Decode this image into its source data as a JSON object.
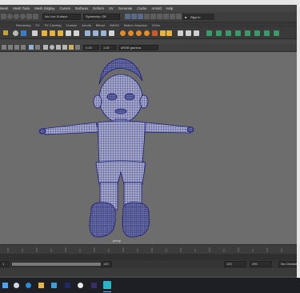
{
  "menu": {
    "items": [
      "Mesh",
      "Mesh Tools",
      "Mesh Display",
      "Curves",
      "Surfaces",
      "Deform",
      "UV",
      "Generate",
      "Cache",
      "Arnold",
      "Help"
    ]
  },
  "status_line": {
    "live_surface": "No Live Surface",
    "symmetry": "Symmetry: Off",
    "sign_in": "Sign In"
  },
  "shelf": {
    "tabs": [
      "Rendering",
      "FX",
      "FX Caching",
      "Custom",
      "Arnold",
      "Bifrost",
      "MASH",
      "Motion Graphics",
      "XGen"
    ]
  },
  "viewport": {
    "toolbar": {
      "value_a": "0.00",
      "value_b": "1.00",
      "color_space": "sRGB gamma"
    },
    "camera_label": "persp"
  },
  "timeline": {
    "range_start": "1",
    "current_frame": "120",
    "range_end": "120",
    "end_frame": "200",
    "character_set": "No Charact"
  },
  "colors": {
    "viewport_bg": "#6d6d6d",
    "wireframe": "#1c1f7a",
    "mesh_fill": "#9a9fbf",
    "accent_blue": "#2a6fd6"
  }
}
